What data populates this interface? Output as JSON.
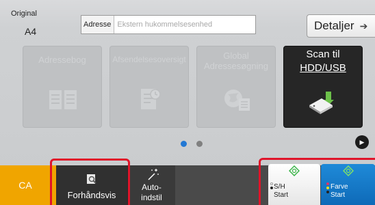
{
  "original": {
    "label": "Original",
    "size": "A4"
  },
  "address": {
    "label": "Adresse",
    "value": "Ekstern hukommelsesenhed"
  },
  "detail_button": {
    "label": "Detaljer",
    "icon": "arrow-right-icon"
  },
  "tiles": [
    {
      "label": "Adressebog",
      "state": "disabled",
      "icon": "address-book-icon"
    },
    {
      "label": "Afsendelsesoversigt",
      "state": "disabled",
      "icon": "send-history-icon"
    },
    {
      "label_line1": "Global",
      "label_line2": "Adressesøgning",
      "state": "disabled",
      "icon": "global-search-icon"
    },
    {
      "label_line1": "Scan til",
      "label_line2": "HDD/USB",
      "state": "active",
      "icon": "usb-drive-icon"
    }
  ],
  "pager": {
    "current": 1,
    "total": 2
  },
  "bottom": {
    "ca_label": "CA",
    "preview_label": "Forhåndsvis",
    "auto_label_line1": "Auto-",
    "auto_label_line2": "indstil",
    "start_bw_line1": "S/H",
    "start_bw_line2": "Start",
    "start_color_line1": "Farve",
    "start_color_line2": "Start"
  },
  "colors": {
    "accent_blue": "#1f8ad8",
    "ca_orange": "#f0a500",
    "highlight_red": "#e0142a",
    "start_green": "#3cb44a"
  }
}
